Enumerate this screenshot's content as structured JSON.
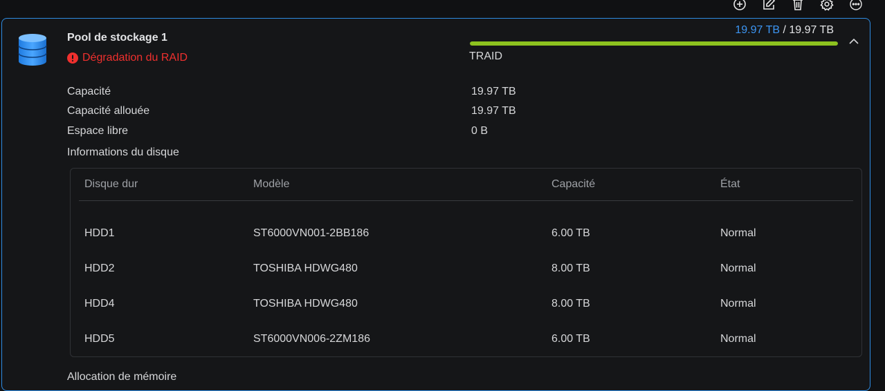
{
  "toolbar": {
    "icons": [
      "add-circle-icon",
      "edit-icon",
      "trash-icon",
      "gear-icon",
      "more-icon"
    ]
  },
  "pool": {
    "name": "Pool de stockage 1",
    "status": "Dégradation du RAID",
    "usage_used": "19.97 TB",
    "usage_separator": " / ",
    "usage_total": "19.97 TB",
    "usage_fraction": 1.0,
    "raid_type": "TRAID",
    "colors": {
      "accent": "#2f8de4",
      "usage_used": "#3c95f2",
      "bar_fill": "#8dc21f",
      "error": "#f0302e"
    }
  },
  "details": [
    {
      "label": "Capacité",
      "value": "19.97 TB"
    },
    {
      "label": "Capacité allouée",
      "value": "19.97 TB"
    },
    {
      "label": "Espace libre",
      "value": "0 B"
    }
  ],
  "disk_section_title": "Informations du disque",
  "disk_table": {
    "columns": [
      "Disque dur",
      "Modèle",
      "Capacité",
      "État"
    ],
    "rows": [
      [
        "HDD1",
        "ST6000VN001-2BB186",
        "6.00 TB",
        "Normal"
      ],
      [
        "HDD2",
        "TOSHIBA HDWG480",
        "8.00 TB",
        "Normal"
      ],
      [
        "HDD4",
        "TOSHIBA HDWG480",
        "8.00 TB",
        "Normal"
      ],
      [
        "HDD5",
        "ST6000VN006-2ZM186",
        "6.00 TB",
        "Normal"
      ]
    ]
  },
  "memory_section_title": "Allocation de mémoire"
}
